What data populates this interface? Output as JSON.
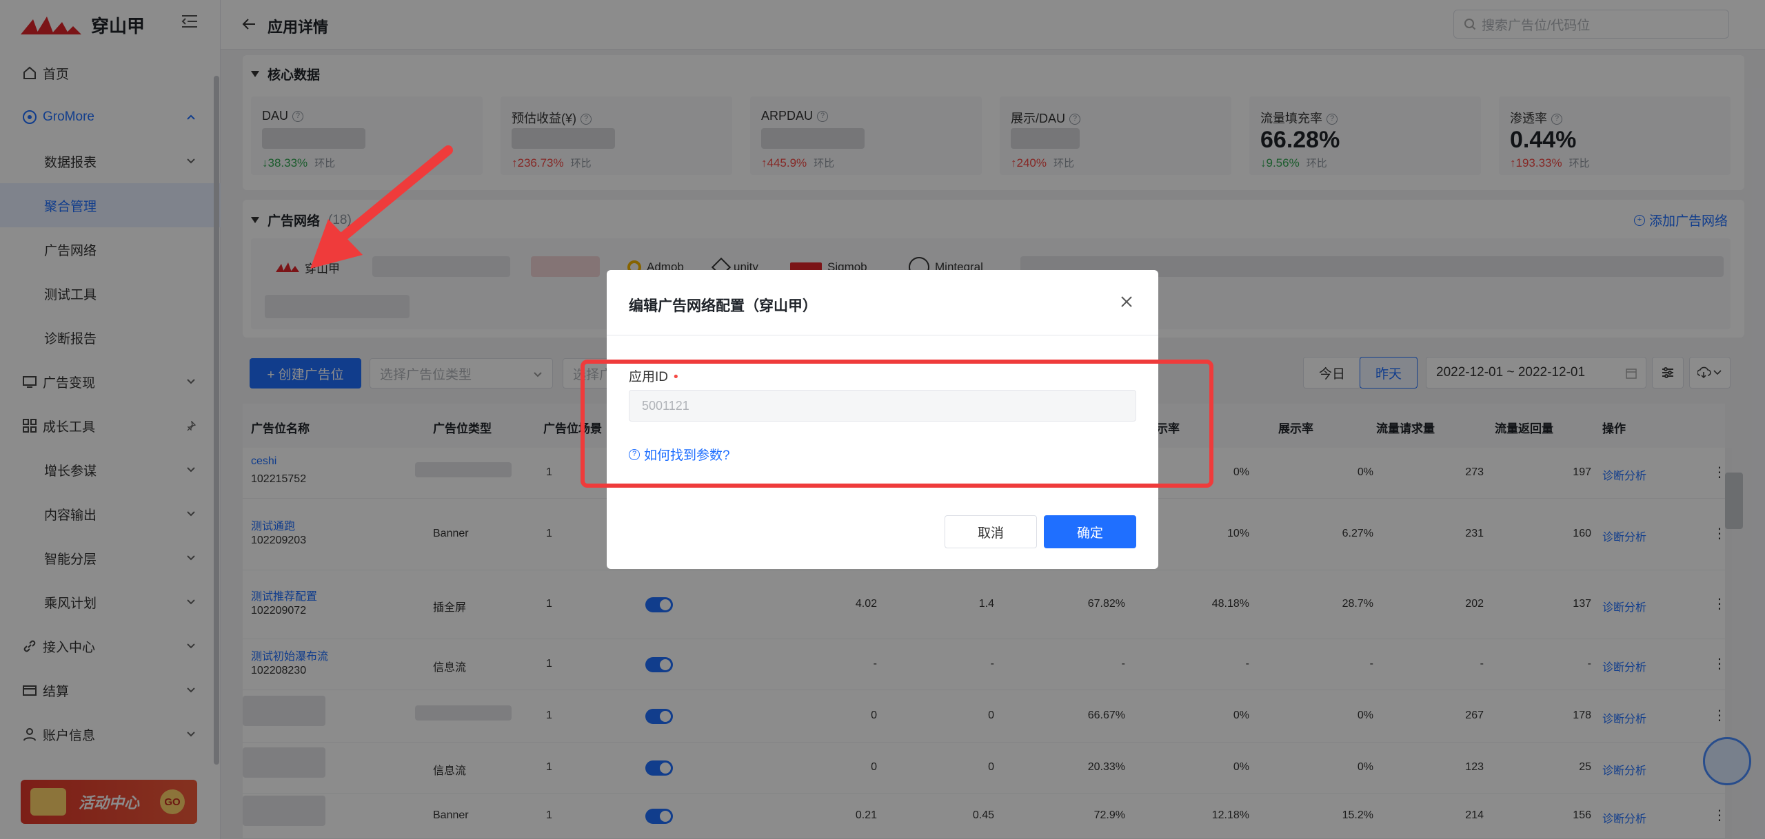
{
  "brand": {
    "name": "穿山甲"
  },
  "sidebar": {
    "items": [
      {
        "label": "首页",
        "icon": "home-icon"
      },
      {
        "label": "GroMore",
        "icon": "gromore-icon"
      },
      {
        "label": "数据报表"
      },
      {
        "label": "聚合管理"
      },
      {
        "label": "广告网络"
      },
      {
        "label": "测试工具"
      },
      {
        "label": "诊断报告"
      },
      {
        "label": "广告变现",
        "icon": "monitor-icon"
      },
      {
        "label": "成长工具",
        "icon": "grid-icon"
      },
      {
        "label": "增长参谋"
      },
      {
        "label": "内容输出"
      },
      {
        "label": "智能分层"
      },
      {
        "label": "乘风计划"
      },
      {
        "label": "接入中心",
        "icon": "link-icon"
      },
      {
        "label": "结算",
        "icon": "card-icon"
      },
      {
        "label": "账户信息",
        "icon": "user-icon"
      }
    ],
    "promo": {
      "label": "活动中心",
      "go": "GO"
    }
  },
  "header": {
    "title": "应用详情",
    "search_placeholder": "搜索广告位/代码位"
  },
  "core": {
    "title": "核心数据",
    "metrics": [
      {
        "label": "DAU",
        "value": "",
        "change": "↓38.33%",
        "dir": "down",
        "cmp": "环比"
      },
      {
        "label": "预估收益(¥)",
        "value": "",
        "change": "↑236.73%",
        "dir": "up",
        "cmp": "环比"
      },
      {
        "label": "ARPDAU",
        "value": "",
        "change": "↑445.9%",
        "dir": "up",
        "cmp": "环比"
      },
      {
        "label": "展示/DAU",
        "value": "",
        "change": "↑240%",
        "dir": "up",
        "cmp": "环比"
      },
      {
        "label": "流量填充率",
        "value": "66.28%",
        "change": "↓9.56%",
        "dir": "down",
        "cmp": "环比"
      },
      {
        "label": "渗透率",
        "value": "0.44%",
        "change": "↑193.33%",
        "dir": "up",
        "cmp": "环比"
      }
    ]
  },
  "networks": {
    "title": "广告网络",
    "count": "(18)",
    "add_label": "添加广告网络",
    "chips": [
      "穿山甲",
      "Admob",
      "unity",
      "Sigmob",
      "Mintegral"
    ]
  },
  "toolbar": {
    "create_label": "+ 创建广告位",
    "type_placeholder": "选择广告位类型",
    "scene_placeholder": "选择广",
    "today": "今日",
    "yesterday": "昨天",
    "date_range": "2022-12-01 ~ 2022-12-01"
  },
  "table": {
    "headers": [
      "广告位名称",
      "广告位类型",
      "广告位场景",
      "展示率",
      "展示率",
      "流量请求量",
      "流量返回量",
      "操作"
    ],
    "rows": [
      {
        "name": "ceshi",
        "id": "102215752",
        "type": "",
        "scene": "1",
        "c1": "0%",
        "c2": "0%",
        "req": "273",
        "ret": "197",
        "op": "诊断分析"
      },
      {
        "name": "测试通跑",
        "id": "102209203",
        "type": "Banner",
        "scene": "1",
        "c1": "10%",
        "c2": "6.27%",
        "req": "231",
        "ret": "160",
        "op": "诊断分析"
      },
      {
        "name": "测试推荐配置",
        "id": "102209072",
        "type": "插全屏",
        "scene": "1",
        "v1": "4.02",
        "v2": "1.4",
        "v3": "67.82%",
        "c1": "48.18%",
        "c2": "28.7%",
        "req": "202",
        "ret": "137",
        "op": "诊断分析"
      },
      {
        "name": "测试初始瀑布流",
        "id": "102208230",
        "type": "信息流",
        "scene": "1",
        "v1": "-",
        "v2": "-",
        "v3": "-",
        "c1": "-",
        "c2": "-",
        "req": "-",
        "ret": "-",
        "op": "诊断分析"
      },
      {
        "name": "",
        "id": "",
        "type": "",
        "scene": "1",
        "v1": "0",
        "v2": "0",
        "v3": "66.67%",
        "c1": "0%",
        "c2": "0%",
        "req": "267",
        "ret": "178",
        "op": "诊断分析"
      },
      {
        "name": "",
        "id": "",
        "type": "信息流",
        "scene": "1",
        "v1": "0",
        "v2": "0",
        "v3": "20.33%",
        "c1": "0%",
        "c2": "0%",
        "req": "123",
        "ret": "25",
        "op": "诊断分析"
      },
      {
        "name": "",
        "id": "",
        "type": "Banner",
        "scene": "1",
        "v1": "0.21",
        "v2": "0.45",
        "v3": "72.9%",
        "c1": "12.18%",
        "c2": "15.2%",
        "req": "214",
        "ret": "156",
        "op": "诊断分析"
      }
    ]
  },
  "dialog": {
    "title": "编辑广告网络配置（穿山甲）",
    "field_label": "应用ID",
    "required_mark": "•",
    "field_value": "5001121",
    "help_link": "如何找到参数?",
    "cancel": "取消",
    "ok": "确定"
  },
  "colors": {
    "accent": "#1f6fff",
    "highlight": "#ef3b3b",
    "up": "#f54a45",
    "down": "#34a853"
  }
}
